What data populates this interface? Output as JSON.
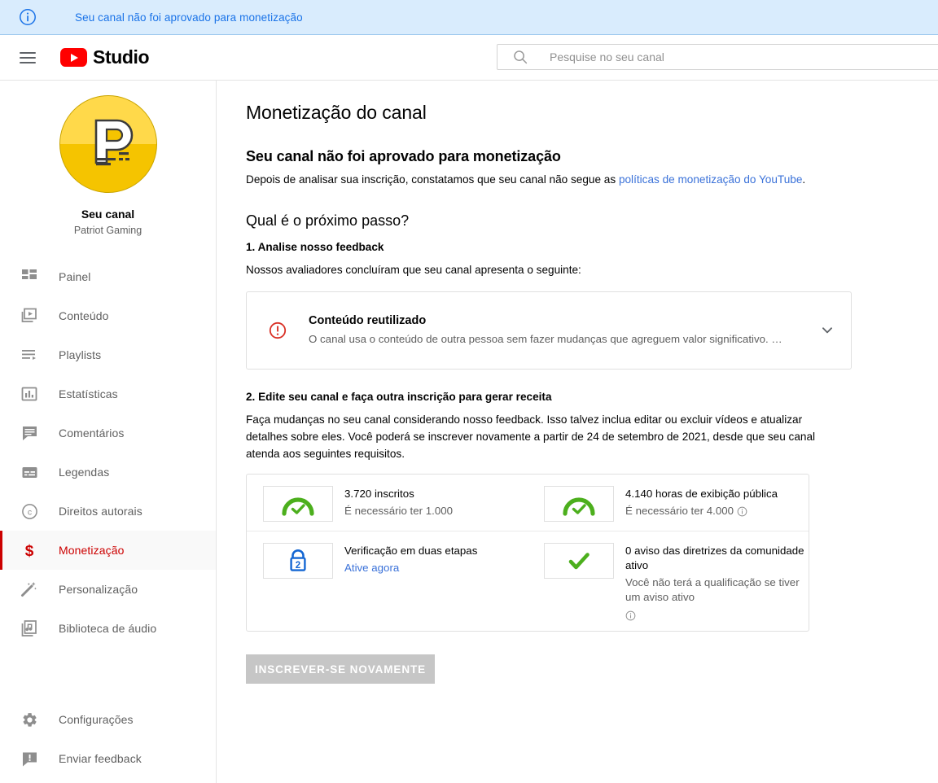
{
  "banner": {
    "icon": "info-circle-icon",
    "text": "Seu canal não foi aprovado para monetização",
    "bg_color": "#d9ecfd",
    "text_color": "#1a73e8"
  },
  "masthead": {
    "menu_icon": "hamburger-menu-icon",
    "logo_icon": "youtube-play-logo-icon",
    "brand": "Studio",
    "search": {
      "icon": "search-icon",
      "placeholder": "Pesquise no seu canal",
      "value": ""
    }
  },
  "sidebar": {
    "channel": {
      "avatar_icon": "channel-avatar-p-logo",
      "avatar_color": "#f5c400",
      "title": "Seu canal",
      "name": "Patriot Gaming"
    },
    "items": [
      {
        "label": "Painel",
        "icon": "dashboard-icon",
        "active": false
      },
      {
        "label": "Conteúdo",
        "icon": "video-frame-icon",
        "active": false
      },
      {
        "label": "Playlists",
        "icon": "playlist-icon",
        "active": false
      },
      {
        "label": "Estatísticas",
        "icon": "bar-chart-icon",
        "active": false
      },
      {
        "label": "Comentários",
        "icon": "comment-icon",
        "active": false
      },
      {
        "label": "Legendas",
        "icon": "subtitles-icon",
        "active": false
      },
      {
        "label": "Direitos autorais",
        "icon": "copyright-icon",
        "active": false
      },
      {
        "label": "Monetização",
        "icon": "dollar-sign-icon",
        "active": true
      },
      {
        "label": "Personalização",
        "icon": "magic-wand-icon",
        "active": false
      },
      {
        "label": "Biblioteca de áudio",
        "icon": "audio-library-icon",
        "active": false
      }
    ],
    "bottom_items": [
      {
        "label": "Configurações",
        "icon": "gear-icon"
      },
      {
        "label": "Enviar feedback",
        "icon": "feedback-icon"
      }
    ],
    "active_color": "#cc0000"
  },
  "main": {
    "page_title": "Monetização do canal",
    "status_heading": "Seu canal não foi aprovado para monetização",
    "status_body_before": "Depois de analisar sua inscrição, constatamos que seu canal não segue as ",
    "status_body_link": "políticas de monetização do YouTube",
    "status_body_after": ".",
    "next_step_heading": "Qual é o próximo passo?",
    "step1": {
      "title": "1. Analise nosso feedback",
      "body": "Nossos avaliadores concluíram que seu canal apresenta o seguinte:",
      "card": {
        "icon": "error-exclamation-circle-icon",
        "icon_color": "#d93025",
        "title": "Conteúdo reutilizado",
        "description": "O canal usa o conteúdo de outra pessoa sem fazer mudanças que agreguem valor significativo. …",
        "expand_icon": "chevron-down-icon"
      }
    },
    "step2": {
      "title": "2. Edite seu canal e faça outra inscrição para gerar receita",
      "body": "Faça mudanças no seu canal considerando nosso feedback. Isso talvez inclua editar ou excluir vídeos e atualizar detalhes sobre eles. Você poderá se inscrever novamente a partir de 24 de setembro de 2021, desde que seu canal atenda aos seguintes requisitos.",
      "requirements": [
        {
          "icon": "green-gauge-check-icon",
          "icon_color": "#4caf1d",
          "main": "3.720 inscritos",
          "sub": "É necessário ter 1.000",
          "has_info": false,
          "link": ""
        },
        {
          "icon": "green-gauge-check-icon",
          "icon_color": "#4caf1d",
          "main": "4.140 horas de exibição pública",
          "sub": "É necessário ter 4.000",
          "has_info": true,
          "link": ""
        },
        {
          "icon": "blue-lock-two-step-icon",
          "icon_color": "#1a73e8",
          "main": "Verificação em duas etapas",
          "sub": "",
          "has_info": false,
          "link": "Ative agora"
        },
        {
          "icon": "green-check-icon",
          "icon_color": "#4caf1d",
          "main": "0 aviso das diretrizes da comunidade ativo",
          "sub": "Você não terá a qualificação se tiver um aviso ativo",
          "has_info": true,
          "link": ""
        }
      ]
    },
    "submit_button": {
      "label": "INSCREVER-SE NOVAMENTE",
      "disabled": true,
      "bg_color": "#c6c6c6"
    }
  }
}
